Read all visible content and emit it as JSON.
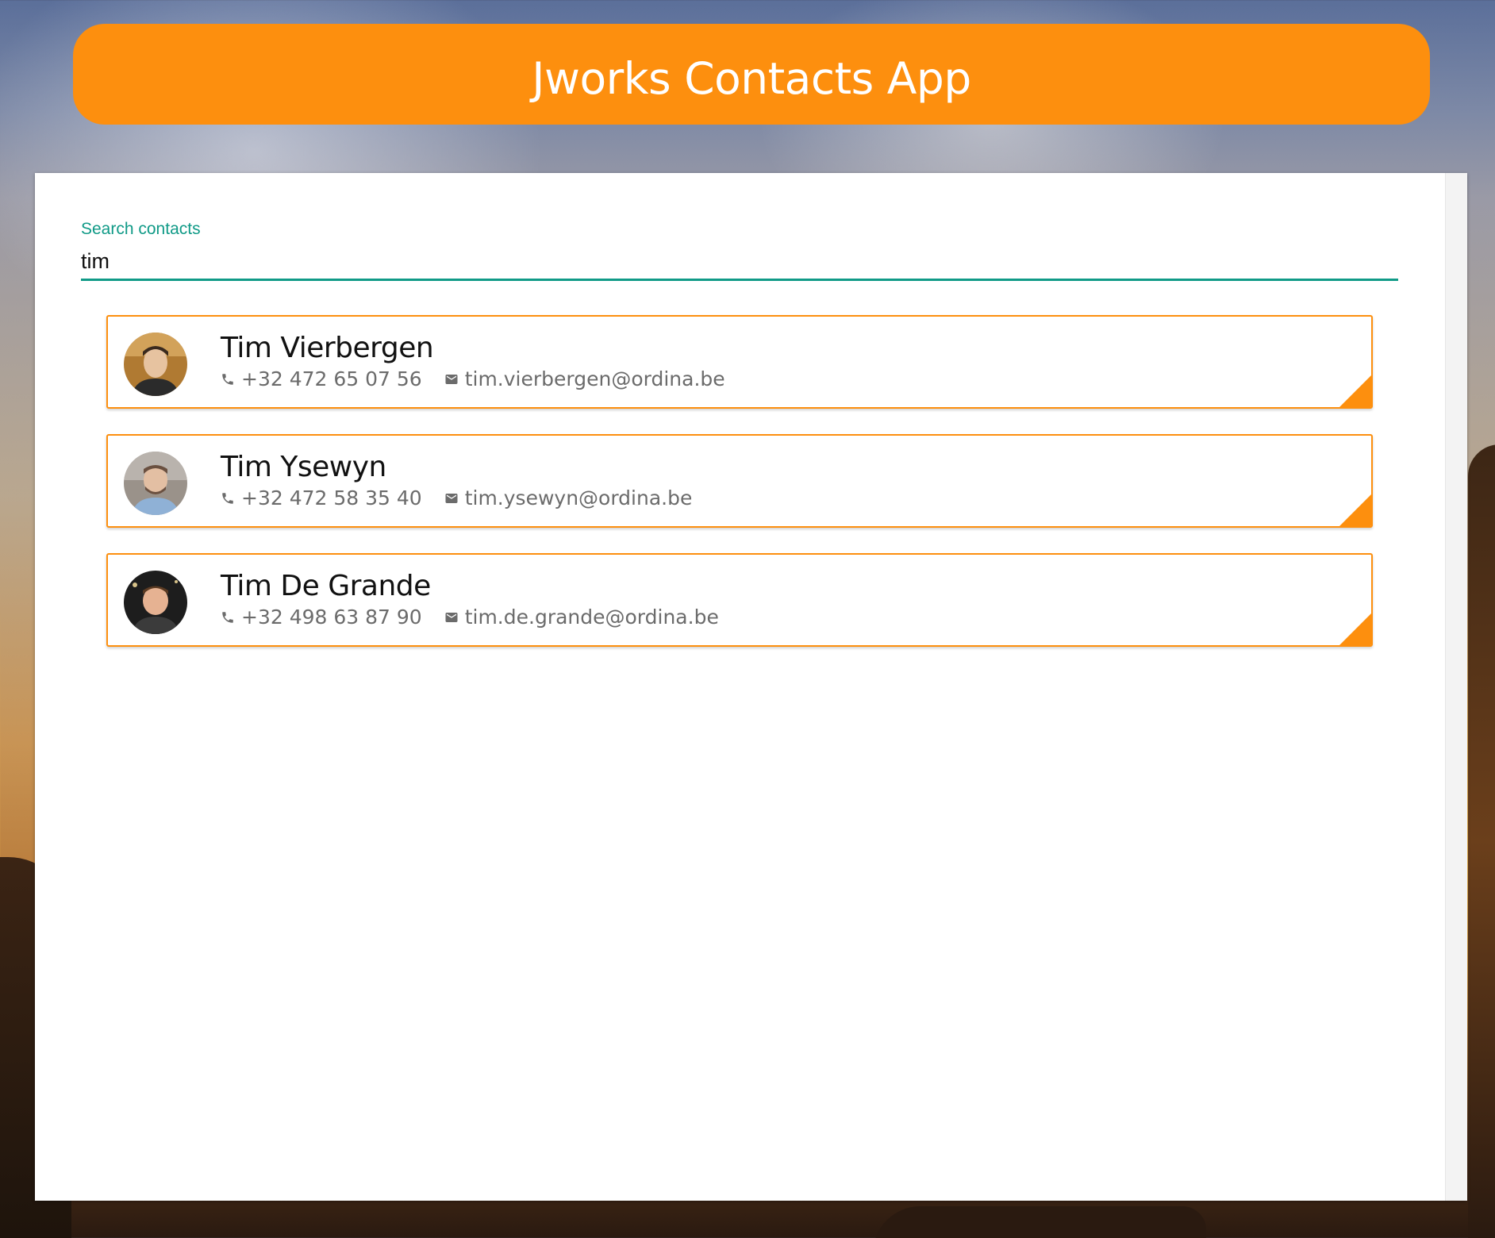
{
  "app": {
    "title": "Jworks Contacts App"
  },
  "colors": {
    "accent": "#fd8f0e",
    "search_accent": "#109a87"
  },
  "search": {
    "label": "Search contacts",
    "value": "tim"
  },
  "contacts": [
    {
      "name": "Tim Vierbergen",
      "phone": "+32 472 65 07 56",
      "email": "tim.vierbergen@ordina.be",
      "phone_icon": "phone-icon",
      "email_icon": "mail-icon"
    },
    {
      "name": "Tim Ysewyn",
      "phone": "+32 472 58 35 40",
      "email": "tim.ysewyn@ordina.be",
      "phone_icon": "phone-icon",
      "email_icon": "mail-icon"
    },
    {
      "name": "Tim De Grande",
      "phone": "+32 498 63 87 90",
      "email": "tim.de.grande@ordina.be",
      "phone_icon": "phone-icon",
      "email_icon": "mail-icon"
    }
  ]
}
